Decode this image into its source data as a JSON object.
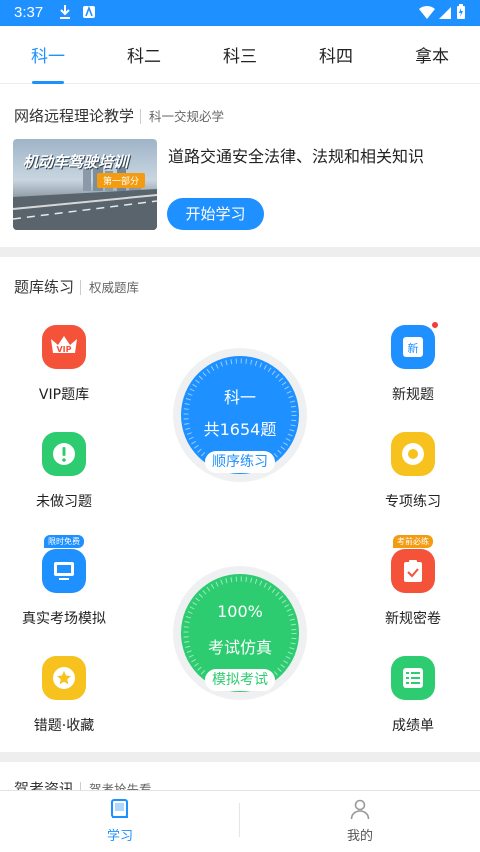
{
  "status_bar": {
    "time": "3:37"
  },
  "tabs": [
    "科一",
    "科二",
    "科三",
    "科四",
    "拿本"
  ],
  "colors": {
    "accent": "#1e90ff",
    "green": "#2ecc71",
    "red": "#f4533a",
    "yellow": "#f7c21e"
  },
  "course": {
    "header": "网络远程理论教学",
    "header_sub": "科一交规必学",
    "image_title": "机动车驾驶培训",
    "image_tag": "第一部分",
    "title": "道路交通安全法律、法规和相关知识",
    "start_button": "开始学习"
  },
  "practice": {
    "header": "题库练习",
    "header_sub": "权威题库",
    "features": [
      {
        "label": "VIP题库",
        "icon": "vip-crown-icon"
      },
      {
        "label": "新规题",
        "icon": "new-book-icon"
      },
      {
        "label": "未做习题",
        "icon": "exclamation-icon"
      },
      {
        "label": "专项练习",
        "icon": "target-icon"
      },
      {
        "label": "真实考场模拟",
        "icon": "monitor-icon",
        "tag": "限时免费"
      },
      {
        "label": "新规密卷",
        "icon": "clipboard-icon",
        "tag": "考前必练"
      },
      {
        "label": "错题·收藏",
        "icon": "star-icon"
      },
      {
        "label": "成绩单",
        "icon": "list-icon"
      }
    ],
    "dial_order": {
      "line1": "科一",
      "line2": "共1654题",
      "button": "顺序练习"
    },
    "dial_exam": {
      "line1": "100%",
      "line2": "考试仿真",
      "button": "模拟考试"
    }
  },
  "next_section": {
    "header": "驾考资讯",
    "header_sub": "驾考抢先看"
  },
  "bottom_nav": {
    "study": "学习",
    "mine": "我的"
  }
}
